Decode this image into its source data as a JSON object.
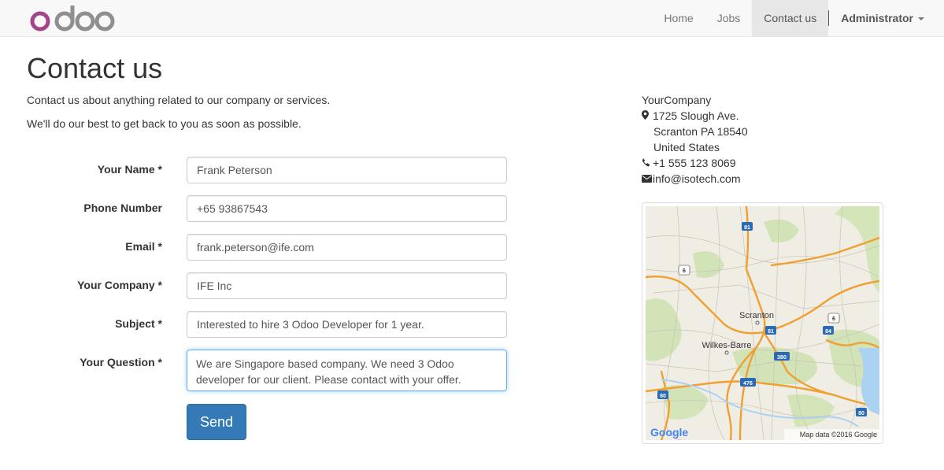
{
  "brand": {
    "logo_text": "odoo"
  },
  "nav": {
    "home": "Home",
    "jobs": "Jobs",
    "contact": "Contact us",
    "user": "Administrator"
  },
  "page": {
    "title": "Contact us",
    "intro1": "Contact us about anything related to our company or services.",
    "intro2": "We'll do our best to get back to you as soon as possible."
  },
  "form": {
    "name_label": "Your Name *",
    "name_value": "Frank Peterson",
    "phone_label": "Phone Number",
    "phone_value": "+65 93867543",
    "email_label": "Email *",
    "email_value": "frank.peterson@ife.com",
    "company_label": "Your Company *",
    "company_value": "IFE Inc",
    "subject_label": "Subject *",
    "subject_value": "Interested to hire 3 Odoo Developer for 1 year.",
    "question_label": "Your Question *",
    "question_value": "We are Singapore based company. We need 3 Odoo developer for our client. Please contact with your offer.",
    "send_label": "Send"
  },
  "company": {
    "name": "YourCompany",
    "street": "1725 Slough Ave.",
    "city": "Scranton PA 18540",
    "country": "United States",
    "phone": "+1 555 123 8069",
    "email": "info@isotech.com"
  },
  "map": {
    "city1": "Scranton",
    "city2": "Wilkes-Barre",
    "hw81a": "81",
    "hw81b": "81",
    "hw6a": "6",
    "hw6b": "6",
    "hw84": "84",
    "hw380": "380",
    "hw476": "476",
    "hw80a": "80",
    "hw80b": "80",
    "attribution": "Map data ©2016 Google",
    "provider": "Google"
  },
  "colors": {
    "primary": "#337ab7",
    "brand_purple": "#a24689",
    "brand_gray": "#8f8f8f",
    "road_orange": "#f0a030",
    "map_bg": "#f0ede5",
    "map_green": "#cfe3b4"
  }
}
